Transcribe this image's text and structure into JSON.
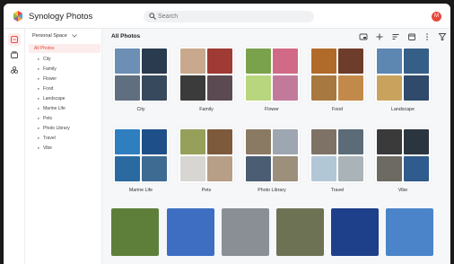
{
  "app": {
    "title": "Synology Photos",
    "avatar_initial": "M"
  },
  "search": {
    "placeholder": "Search"
  },
  "sidebar": {
    "space_label": "Personal Space",
    "all_photos": "All Photos",
    "items": [
      "City",
      "Family",
      "Flower",
      "Food",
      "Landscape",
      "Marine Life",
      "Pets",
      "Photo Library",
      "Travel",
      "Vibe"
    ]
  },
  "main": {
    "title": "All Photos"
  },
  "toolbar": {
    "icons": [
      "select-icon",
      "add-icon",
      "sort-icon",
      "calendar-icon",
      "more-icon",
      "filter-icon"
    ]
  },
  "albums": [
    {
      "label": "City",
      "colors": [
        "#6b8fb5",
        "#2a3b4f",
        "#5f6f80",
        "#37495c"
      ]
    },
    {
      "label": "Family",
      "colors": [
        "#c8a98d",
        "#9f3a35",
        "#3b3b3b",
        "#5c4a52"
      ]
    },
    {
      "label": "Flower",
      "colors": [
        "#7aa24c",
        "#d06a86",
        "#b8d67e",
        "#c27a9b"
      ]
    },
    {
      "label": "Food",
      "colors": [
        "#b06a2a",
        "#6e3c2a",
        "#a7783f",
        "#c28a4a"
      ]
    },
    {
      "label": "Landscape",
      "colors": [
        "#5d86b1",
        "#365f88",
        "#c9a35e",
        "#2f4a6b"
      ]
    },
    {
      "label": "Marine Life",
      "colors": [
        "#2f7fc0",
        "#1f4f88",
        "#2a6aa0",
        "#3e6b92"
      ]
    },
    {
      "label": "Pets",
      "colors": [
        "#96a05a",
        "#7d5a3c",
        "#d8d6d2",
        "#b79e86"
      ]
    },
    {
      "label": "Photo Library",
      "colors": [
        "#8b7a63",
        "#9ea6b1",
        "#4b5d72",
        "#9c8f7b"
      ]
    },
    {
      "label": "Travel",
      "colors": [
        "#7d7265",
        "#5b6b78",
        "#b2c7d6",
        "#a9b3b8"
      ]
    },
    {
      "label": "Vibe",
      "colors": [
        "#3a3a3a",
        "#2b3540",
        "#6d6a63",
        "#2f5c8c"
      ]
    }
  ],
  "photos": [
    {
      "name": "photo-1",
      "color": "#5e7f3a"
    },
    {
      "name": "photo-2",
      "color": "#3d6ec2"
    },
    {
      "name": "photo-3",
      "color": "#8a8f96"
    },
    {
      "name": "photo-4",
      "color": "#6d7255"
    },
    {
      "name": "photo-5",
      "color": "#1e3f8a"
    },
    {
      "name": "photo-6",
      "color": "#4b84c9"
    }
  ]
}
